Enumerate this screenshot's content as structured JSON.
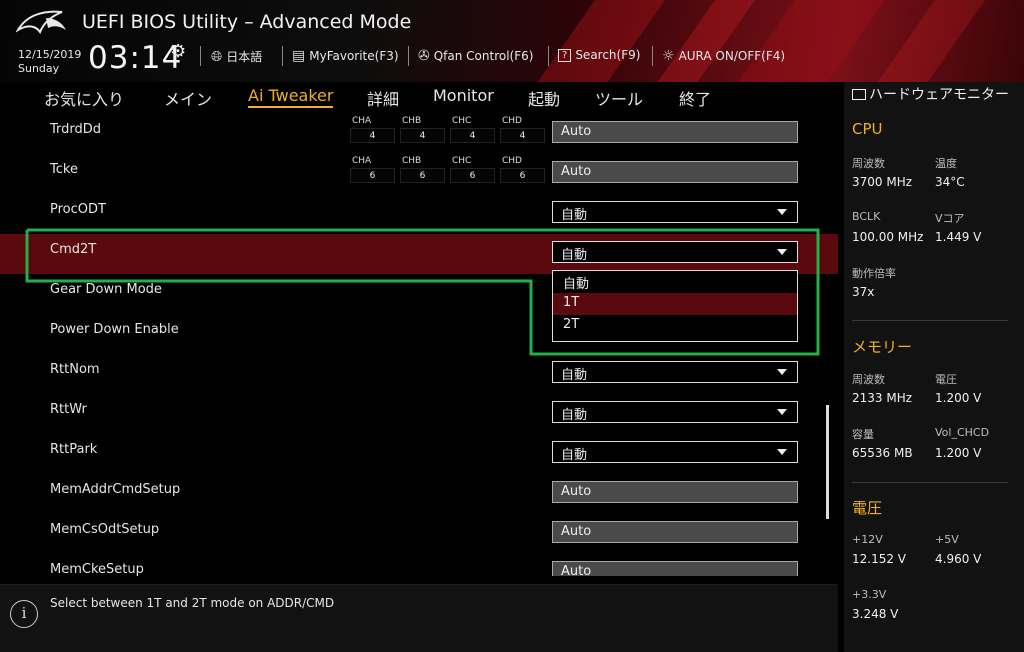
{
  "header": {
    "title": "UEFI BIOS Utility – Advanced Mode",
    "date": "12/15/2019",
    "day": "Sunday",
    "time": "03:14",
    "buttons": [
      {
        "icon": "globe-icon",
        "label": "日本語"
      },
      {
        "icon": "myfavorite-icon",
        "label": "MyFavorite(F3)"
      },
      {
        "icon": "fan-icon",
        "label": "Qfan Control(F6)"
      },
      {
        "icon": "search-help-icon",
        "label": "Search(F9)"
      },
      {
        "icon": "aura-icon",
        "label": "AURA ON/OFF(F4)"
      }
    ]
  },
  "nav": {
    "tabs": [
      "お気に入り",
      "メイン",
      "Ai Tweaker",
      "詳細",
      "Monitor",
      "起動",
      "ツール",
      "終了"
    ],
    "active": "Ai Tweaker"
  },
  "settings": [
    {
      "label": "TrdrdDd",
      "type": "channels",
      "channels": [
        {
          "name": "CHA",
          "value": "4"
        },
        {
          "name": "CHB",
          "value": "4"
        },
        {
          "name": "CHC",
          "value": "4"
        },
        {
          "name": "CHD",
          "value": "4"
        }
      ],
      "value": "Auto"
    },
    {
      "label": "Tcke",
      "type": "channels",
      "channels": [
        {
          "name": "CHA",
          "value": "6"
        },
        {
          "name": "CHB",
          "value": "6"
        },
        {
          "name": "CHC",
          "value": "6"
        },
        {
          "name": "CHD",
          "value": "6"
        }
      ],
      "value": "Auto"
    },
    {
      "label": "ProcODT",
      "type": "select",
      "value": "自動"
    },
    {
      "label": "Cmd2T",
      "type": "select",
      "value": "自動",
      "selected": true
    },
    {
      "label": "Gear Down Mode",
      "type": "hidden",
      "value": ""
    },
    {
      "label": "Power Down Enable",
      "type": "hidden",
      "value": ""
    },
    {
      "label": "RttNom",
      "type": "select",
      "value": "自動"
    },
    {
      "label": "RttWr",
      "type": "select",
      "value": "自動"
    },
    {
      "label": "RttPark",
      "type": "select",
      "value": "自動"
    },
    {
      "label": "MemAddrCmdSetup",
      "type": "field",
      "value": "Auto"
    },
    {
      "label": "MemCsOdtSetup",
      "type": "field",
      "value": "Auto"
    },
    {
      "label": "MemCkeSetup",
      "type": "field",
      "value": "Auto"
    }
  ],
  "dropdown": {
    "options": [
      "自動",
      "1T",
      "2T"
    ],
    "highlighted": "1T"
  },
  "help": {
    "text": "Select between 1T and 2T mode on ADDR/CMD"
  },
  "hwmon": {
    "title": "ハードウェアモニター",
    "cpu": {
      "heading": "CPU",
      "freq_label": "周波数",
      "freq": "3700 MHz",
      "temp_label": "温度",
      "temp": "34°C",
      "bclk_label": "BCLK",
      "bclk": "100.00 MHz",
      "vcore_label": "Vコア",
      "vcore": "1.449 V",
      "ratio_label": "動作倍率",
      "ratio": "37x"
    },
    "memory": {
      "heading": "メモリー",
      "freq_label": "周波数",
      "freq": "2133 MHz",
      "volt_label": "電圧",
      "volt": "1.200 V",
      "cap_label": "容量",
      "cap": "65536 MB",
      "vchcd_label": "Vol_CHCD",
      "vchcd": "1.200 V"
    },
    "voltage": {
      "heading": "電圧",
      "v12_label": "+12V",
      "v12": "12.152 V",
      "v5_label": "+5V",
      "v5": "4.960 V",
      "v33_label": "+3.3V",
      "v33": "3.248 V"
    }
  },
  "colors": {
    "accent": "#f0b020",
    "selected_row": "#5a0a0e",
    "highlight_outline": "#22b04a"
  }
}
